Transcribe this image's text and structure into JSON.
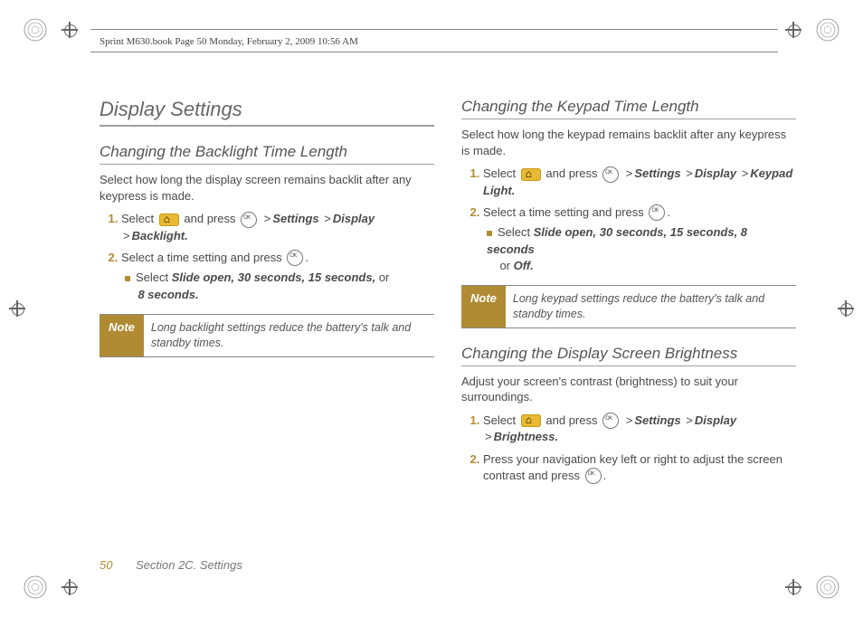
{
  "header": "Sprint M630.book  Page 50  Monday, February 2, 2009  10:56 AM",
  "col1": {
    "title": "Display Settings",
    "sub1": "Changing the Backlight Time Length",
    "lead1": "Select how long the display screen remains backlit after any keypress is made.",
    "s1a": "Select",
    "s1b": "and press",
    "path1a": "Settings",
    "path1b": "Display",
    "path1c": "Backlight.",
    "s2": "Select a time setting and press",
    "sub_sel": "Select",
    "opts": "Slide open, 30 seconds, 15 seconds,",
    "or": "or",
    "opts2": "8 seconds.",
    "note_label": "Note",
    "note_text": "Long backlight settings reduce the battery's talk and standby times."
  },
  "col2": {
    "sub1": "Changing the Keypad Time Length",
    "lead1": "Select how long the keypad remains backlit after any keypress is made.",
    "s1a": "Select",
    "s1b": "and press",
    "path1a": "Settings",
    "path1b": "Display",
    "path1c": "Keypad Light.",
    "s2": "Select a time setting and press",
    "sub_sel": "Select",
    "opts": "Slide open, 30 seconds, 15 seconds, 8 seconds",
    "or": "or",
    "optoff": "Off.",
    "note_label": "Note",
    "note_text": "Long keypad settings reduce the battery's talk and standby times.",
    "sub2": "Changing the Display Screen Brightness",
    "lead2": "Adjust your screen's contrast (brightness) to suit your  surroundings.",
    "b_s1a": "Select",
    "b_s1b": "and press",
    "b_path1a": "Settings",
    "b_path1b": "Display",
    "b_path1c": "Brightness.",
    "b_s2": "Press your navigation key left or right to adjust the screen contrast and press"
  },
  "footer": {
    "page": "50",
    "section": "Section 2C. Settings"
  },
  "gt": ">"
}
